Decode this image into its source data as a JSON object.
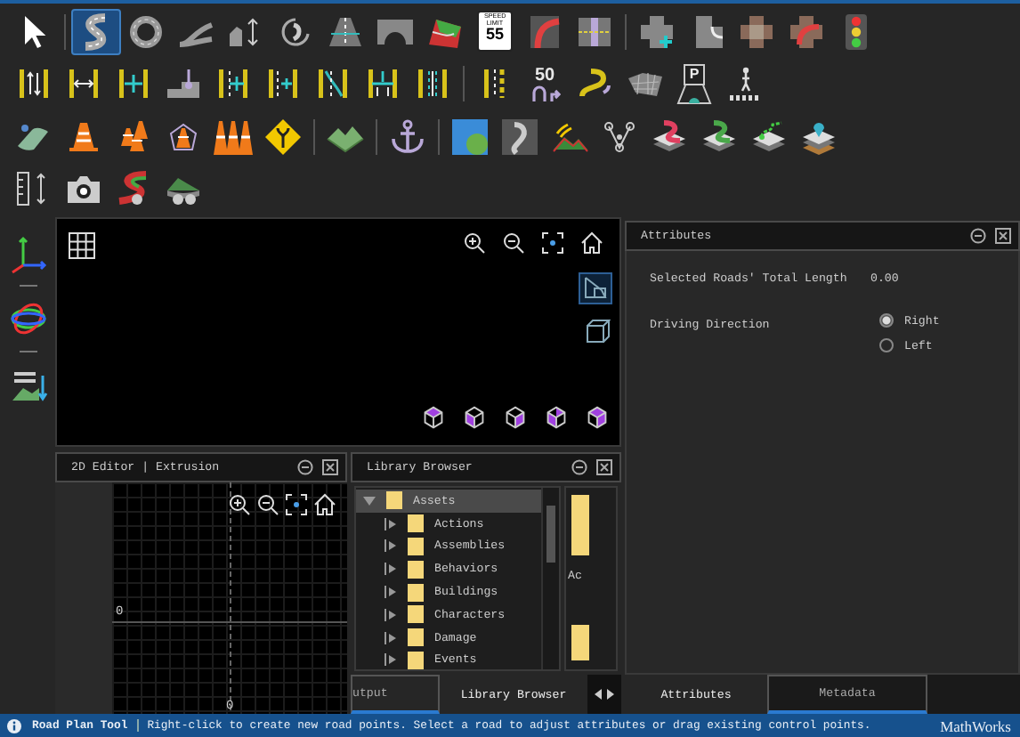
{
  "toolbar": {
    "rows": [
      {
        "groups": [
          [
            {
              "kind": "pointer",
              "selected": false
            }
          ],
          [
            {
              "kind": "road",
              "selected": true
            },
            {
              "kind": "roundabout",
              "selected": false
            },
            {
              "kind": "road-split",
              "selected": false
            },
            {
              "kind": "elevation",
              "selected": false
            },
            {
              "kind": "spiral",
              "selected": false
            },
            {
              "kind": "lane",
              "selected": false
            },
            {
              "kind": "bridge",
              "selected": false
            },
            {
              "kind": "surface",
              "selected": false
            },
            {
              "kind": "speed-sign",
              "selected": false,
              "caption": "SPEED LIMIT",
              "number": "55"
            },
            {
              "kind": "curve",
              "selected": false
            },
            {
              "kind": "lane-merge",
              "selected": false
            }
          ],
          [
            {
              "kind": "junction",
              "selected": false
            },
            {
              "kind": "junction-corner",
              "selected": false
            },
            {
              "kind": "junction-paved",
              "selected": false
            },
            {
              "kind": "junction-turn",
              "selected": false
            },
            {
              "kind": "signal",
              "selected": false
            }
          ]
        ]
      },
      {
        "groups": [
          [
            {
              "kind": "lane-select",
              "selected": false
            },
            {
              "kind": "lane-width",
              "selected": false
            },
            {
              "kind": "lane-add",
              "selected": false
            },
            {
              "kind": "lane-offset",
              "selected": false
            },
            {
              "kind": "lane-insert",
              "selected": false
            },
            {
              "kind": "lane-form",
              "selected": false
            },
            {
              "kind": "lane-carve",
              "selected": false
            },
            {
              "kind": "lane-split",
              "selected": false
            },
            {
              "kind": "lane-marking",
              "selected": false
            }
          ],
          [
            {
              "kind": "lane-dashed",
              "selected": false
            },
            {
              "kind": "turn-sign",
              "selected": false,
              "number": "50"
            },
            {
              "kind": "s-curve",
              "selected": false
            },
            {
              "kind": "mesh",
              "selected": false
            },
            {
              "kind": "parking",
              "selected": false,
              "letter": "P"
            },
            {
              "kind": "crosswalk",
              "selected": false
            }
          ]
        ]
      },
      {
        "groups": [
          [
            {
              "kind": "area",
              "selected": false
            },
            {
              "kind": "cone",
              "selected": false
            },
            {
              "kind": "cones",
              "selected": false
            },
            {
              "kind": "cone-polygon",
              "selected": false
            },
            {
              "kind": "cone-row",
              "selected": false
            },
            {
              "kind": "diamond-sign",
              "selected": false
            }
          ],
          [
            {
              "kind": "terrain",
              "selected": false
            }
          ],
          [
            {
              "kind": "anchor",
              "selected": false
            }
          ],
          [
            {
              "kind": "map-tile",
              "selected": false
            },
            {
              "kind": "heightmap",
              "selected": false
            },
            {
              "kind": "vegetation",
              "selected": false
            },
            {
              "kind": "nodes",
              "selected": false
            },
            {
              "kind": "layer-red",
              "selected": false
            },
            {
              "kind": "layer-green",
              "selected": false
            },
            {
              "kind": "layer-path",
              "selected": false
            },
            {
              "kind": "layer-pin",
              "selected": false
            }
          ]
        ]
      },
      {
        "groups": [
          [
            {
              "kind": "ruler",
              "selected": false
            },
            {
              "kind": "camera",
              "selected": false
            },
            {
              "kind": "scenario-road",
              "selected": false
            },
            {
              "kind": "scenario-hill",
              "selected": false
            }
          ]
        ]
      }
    ]
  },
  "side_toolbar": [
    {
      "kind": "axes"
    },
    {
      "kind": "orbit"
    },
    {
      "kind": "terrain-drop"
    }
  ],
  "viewport": {
    "view_modes": [
      {
        "kind": "perspective",
        "selected": true
      },
      {
        "kind": "orthographic",
        "selected": false
      }
    ]
  },
  "editor_2d": {
    "title": "2D Editor | Extrusion",
    "axis_labels": [
      "0",
      "0"
    ]
  },
  "library_browser": {
    "title": "Library Browser",
    "tree": [
      {
        "label": "Assets",
        "expanded": true,
        "selected": true,
        "children": [
          {
            "label": "Actions",
            "expanded": false,
            "selected": false
          },
          {
            "label": "Assemblies",
            "expanded": false,
            "selected": false
          },
          {
            "label": "Behaviors",
            "expanded": false,
            "selected": false
          },
          {
            "label": "Buildings",
            "expanded": false,
            "selected": false
          },
          {
            "label": "Characters",
            "expanded": false,
            "selected": false
          },
          {
            "label": "Damage",
            "expanded": false,
            "selected": false
          },
          {
            "label": "Events",
            "expanded": false,
            "selected": false
          }
        ]
      }
    ],
    "preview_label": "Ac",
    "tabs": [
      {
        "label": "utput",
        "selected": false
      },
      {
        "label": "Library Browser",
        "selected": true
      }
    ]
  },
  "attributes": {
    "title": "Attributes",
    "fields": [
      {
        "kind": "value",
        "label": "Selected Roads' Total Length",
        "value": "0.00"
      },
      {
        "kind": "radio",
        "label": "Driving Direction",
        "options": [
          {
            "label": "Right",
            "selected": true
          },
          {
            "label": "Left",
            "selected": false
          }
        ]
      }
    ],
    "tabs": [
      {
        "label": "Attributes",
        "selected": true
      },
      {
        "label": "Metadata",
        "selected": false
      }
    ]
  },
  "status_bar": {
    "tool": "Road Plan Tool",
    "message": "Right-click to create new road points. Select a road to adjust attributes or drag existing control points.",
    "brand": "MathWorks"
  }
}
